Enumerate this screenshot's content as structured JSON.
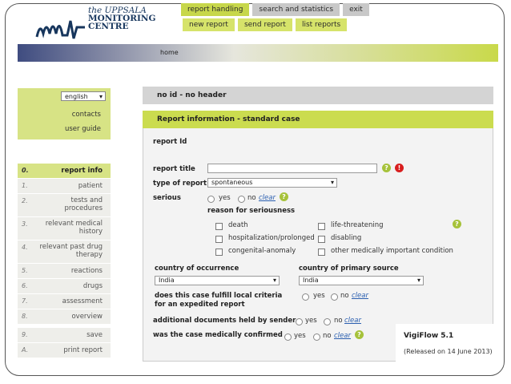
{
  "logo": {
    "line1": "the UPPSALA",
    "line2": "MONITORING",
    "line3": "CENTRE"
  },
  "topnav": {
    "tabs": [
      {
        "label": "report handling"
      },
      {
        "label": "search and statistics"
      },
      {
        "label": "exit"
      }
    ],
    "subtabs": [
      {
        "label": "new report"
      },
      {
        "label": "send report"
      },
      {
        "label": "list reports"
      }
    ]
  },
  "breadcrumb": {
    "home": "home"
  },
  "sidebar": {
    "language": "english",
    "contacts": "contacts",
    "user_guide": "user guide",
    "menu": [
      {
        "num": "0.",
        "label": "report info"
      },
      {
        "num": "1.",
        "label": "patient"
      },
      {
        "num": "2.",
        "label": "tests and procedures"
      },
      {
        "num": "3.",
        "label": "relevant medical history"
      },
      {
        "num": "4.",
        "label": "relevant past drug therapy"
      },
      {
        "num": "5.",
        "label": "reactions"
      },
      {
        "num": "6.",
        "label": "drugs"
      },
      {
        "num": "7.",
        "label": "assessment"
      },
      {
        "num": "8.",
        "label": "overview"
      },
      {
        "num": "9.",
        "label": "save"
      },
      {
        "num": "A.",
        "label": "print report"
      }
    ]
  },
  "main": {
    "id_header": "no id - no header",
    "section_header": "Report information - standard case",
    "report_id_label": "report Id",
    "report_title_label": "report title",
    "report_title_value": "",
    "type_of_report_label": "type of report",
    "type_of_report_value": "spontaneous",
    "serious_label": "serious",
    "yes": "yes",
    "no": "no",
    "clear": "clear",
    "reason_label": "reason for seriousness",
    "reasons": {
      "death": "death",
      "hospitalization": "hospitalization/prolonged",
      "congenital": "congenital-anomaly",
      "life_threatening": "life-threatening",
      "disabling": "disabling",
      "other": "other medically important condition"
    },
    "country_occurrence_label": "country of occurrence",
    "country_occurrence_value": "India",
    "country_source_label": "country of primary source",
    "country_source_value": "India",
    "local_criteria_label_1": "does this case fulfill local criteria",
    "local_criteria_label_2": "for an expedited report",
    "additional_docs_label": "additional documents held by sender",
    "medically_confirmed_label": "was the case medically confirmed"
  },
  "version": {
    "name": "VigiFlow 5.1",
    "released": "(Released on 14 June 2013)"
  },
  "colors": {
    "accent": "#c9d94a",
    "navy": "#17365d",
    "error": "#d81e1e",
    "link": "#2b5fb0"
  }
}
